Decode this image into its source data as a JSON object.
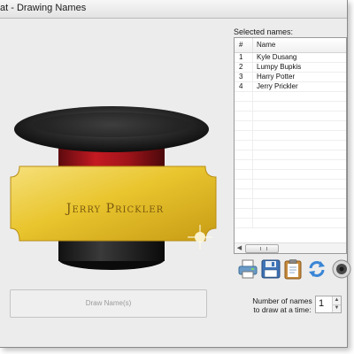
{
  "window": {
    "title": "at - Drawing Names"
  },
  "list": {
    "label": "Selected names:",
    "columns": [
      "#",
      "Name"
    ],
    "rows": [
      {
        "num": "1",
        "name": "Kyle Dusang"
      },
      {
        "num": "2",
        "name": "Lumpy Bupkis"
      },
      {
        "num": "3",
        "name": "Harry Potter"
      },
      {
        "num": "4",
        "name": "Jerry Prickler"
      }
    ]
  },
  "hat": {
    "ticket_name": "Jerry Prickler"
  },
  "toolbar": {
    "icons": [
      "printer-icon",
      "save-disk-icon",
      "clipboard-icon",
      "refresh-icon",
      "sound-speaker-icon"
    ]
  },
  "actions": {
    "draw_label": "Draw Name(s)"
  },
  "draw_count": {
    "label": "Number of names to draw at a time:",
    "value": "1"
  },
  "colors": {
    "accent_gold": "#e9c52e",
    "hat_band": "#b3141c"
  }
}
